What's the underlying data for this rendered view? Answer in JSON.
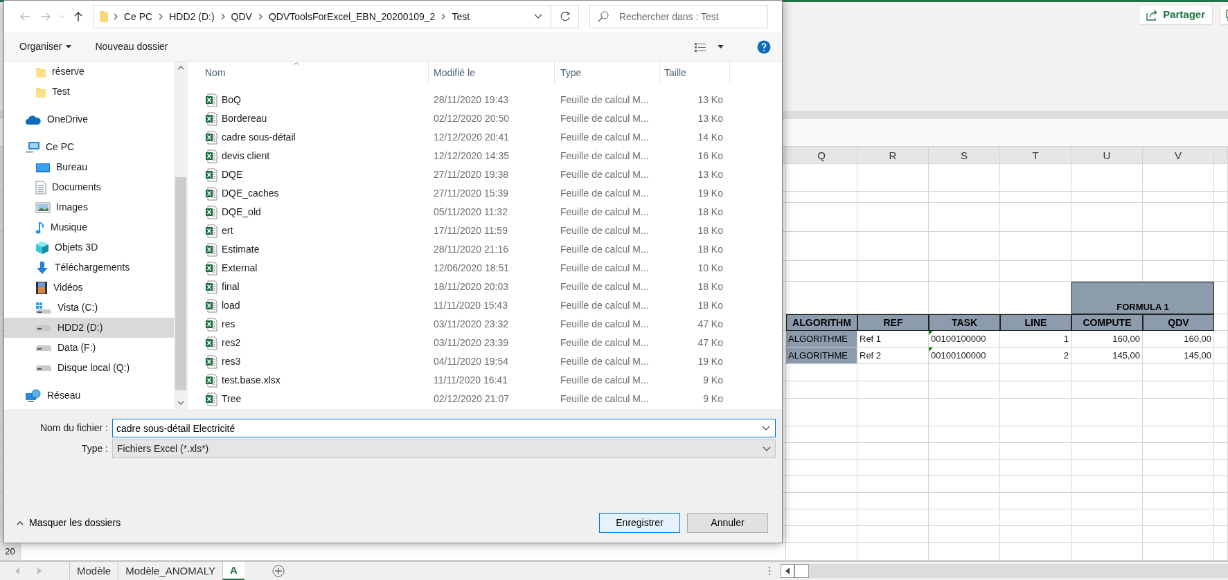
{
  "dialog": {
    "address": {
      "crumbs": [
        "Ce PC",
        "HDD2 (D:)",
        "QDV",
        "QDVToolsForExcel_EBN_20200109_2",
        "Test"
      ]
    },
    "search": {
      "placeholder": "Rechercher dans : Test"
    },
    "toolbar": {
      "organize": "Organiser",
      "new_folder": "Nouveau dossier"
    },
    "sidebar": {
      "items": [
        {
          "label": "réserve",
          "kind": "folder",
          "selected": false
        },
        {
          "label": "Test",
          "kind": "folder",
          "selected": false
        },
        {
          "label": "OneDrive",
          "kind": "cloud",
          "selected": false
        },
        {
          "label": "Ce PC",
          "kind": "pc",
          "selected": false,
          "children": [
            {
              "label": "Bureau",
              "kind": "desktop",
              "selected": false
            },
            {
              "label": "Documents",
              "kind": "documents",
              "selected": false
            },
            {
              "label": "Images",
              "kind": "pictures",
              "selected": false
            },
            {
              "label": "Musique",
              "kind": "music",
              "selected": false
            },
            {
              "label": "Objets 3D",
              "kind": "objects3d",
              "selected": false
            },
            {
              "label": "Téléchargements",
              "kind": "downloads",
              "selected": false
            },
            {
              "label": "Vidéos",
              "kind": "videos",
              "selected": false
            },
            {
              "label": "Vista (C:)",
              "kind": "windows-drive",
              "selected": false
            },
            {
              "label": "HDD2 (D:)",
              "kind": "drive",
              "selected": true
            },
            {
              "label": "Data (F:)",
              "kind": "drive",
              "selected": false
            },
            {
              "label": "Disque local (Q:)",
              "kind": "drive",
              "selected": false
            }
          ]
        },
        {
          "label": "Réseau",
          "kind": "network",
          "selected": false
        }
      ]
    },
    "file_list": {
      "columns": [
        {
          "label": "Nom",
          "sorted": true
        },
        {
          "label": "Modifié le",
          "sorted": false
        },
        {
          "label": "Type",
          "sorted": false
        },
        {
          "label": "Taille",
          "sorted": false
        }
      ],
      "rows": [
        {
          "name": "BoQ",
          "modified": "28/11/2020 19:43",
          "type": "Feuille de calcul M...",
          "size": "13 Ko"
        },
        {
          "name": "Bordereau",
          "modified": "02/12/2020 20:50",
          "type": "Feuille de calcul M...",
          "size": "13 Ko"
        },
        {
          "name": "cadre sous-détail",
          "modified": "12/12/2020 20:41",
          "type": "Feuille de calcul M...",
          "size": "14 Ko"
        },
        {
          "name": "devis client",
          "modified": "12/12/2020 14:35",
          "type": "Feuille de calcul M...",
          "size": "16 Ko"
        },
        {
          "name": "DQE",
          "modified": "27/11/2020 19:38",
          "type": "Feuille de calcul M...",
          "size": "13 Ko"
        },
        {
          "name": "DQE_caches",
          "modified": "27/11/2020 15:39",
          "type": "Feuille de calcul M...",
          "size": "19 Ko"
        },
        {
          "name": "DQE_old",
          "modified": "05/11/2020 11:32",
          "type": "Feuille de calcul M...",
          "size": "18 Ko"
        },
        {
          "name": "ert",
          "modified": "17/11/2020 11:59",
          "type": "Feuille de calcul M...",
          "size": "18 Ko"
        },
        {
          "name": "Estimate",
          "modified": "28/11/2020 21:16",
          "type": "Feuille de calcul M...",
          "size": "18 Ko"
        },
        {
          "name": "External",
          "modified": "12/06/2020 18:51",
          "type": "Feuille de calcul M...",
          "size": "10 Ko"
        },
        {
          "name": "final",
          "modified": "18/11/2020 20:03",
          "type": "Feuille de calcul M...",
          "size": "18 Ko"
        },
        {
          "name": "load",
          "modified": "11/11/2020 15:43",
          "type": "Feuille de calcul M...",
          "size": "18 Ko"
        },
        {
          "name": "res",
          "modified": "03/11/2020 23:32",
          "type": "Feuille de calcul M...",
          "size": "47 Ko"
        },
        {
          "name": "res2",
          "modified": "03/11/2020 23:39",
          "type": "Feuille de calcul M...",
          "size": "47 Ko"
        },
        {
          "name": "res3",
          "modified": "04/11/2020 19:54",
          "type": "Feuille de calcul M...",
          "size": "19 Ko"
        },
        {
          "name": "test.base.xlsx",
          "modified": "11/11/2020 16:41",
          "type": "Feuille de calcul M...",
          "size": "9 Ko"
        },
        {
          "name": "Tree",
          "modified": "02/12/2020 21:07",
          "type": "Feuille de calcul M...",
          "size": "9 Ko"
        }
      ]
    },
    "filename": {
      "label": "Nom du fichier :",
      "value": "cadre sous-détail Electricité"
    },
    "file_type": {
      "label": "Type :",
      "value": "Fichiers Excel (*.xls*)"
    },
    "hide_folders": "Masquer les dossiers",
    "buttons": [
      {
        "label": "Enregistrer",
        "default": true
      },
      {
        "label": "Annuler",
        "default": false
      }
    ]
  },
  "excel": {
    "share": "Partager",
    "columns": [
      "Q",
      "R",
      "S",
      "T",
      "U",
      "V"
    ],
    "sheet": {
      "merged_title": "FORMULA 1",
      "header": [
        "ALGORITHM",
        "REF",
        "TASK",
        "LINE",
        "COMPUTE",
        "QDV"
      ],
      "rows": [
        [
          "ALGORITHME",
          "Ref 1",
          "00100100000",
          "1",
          "160,00",
          "160,00"
        ],
        [
          "ALGORITHME",
          "Ref 2",
          "00100100000",
          "2",
          "145,00",
          "145,00"
        ]
      ]
    },
    "row_label": "20",
    "sheet_tabs": [
      {
        "label": "Modèle",
        "selected": false
      },
      {
        "label": "Modèle_ANOMALY",
        "selected": false
      },
      {
        "label": "A",
        "selected": true
      }
    ]
  }
}
